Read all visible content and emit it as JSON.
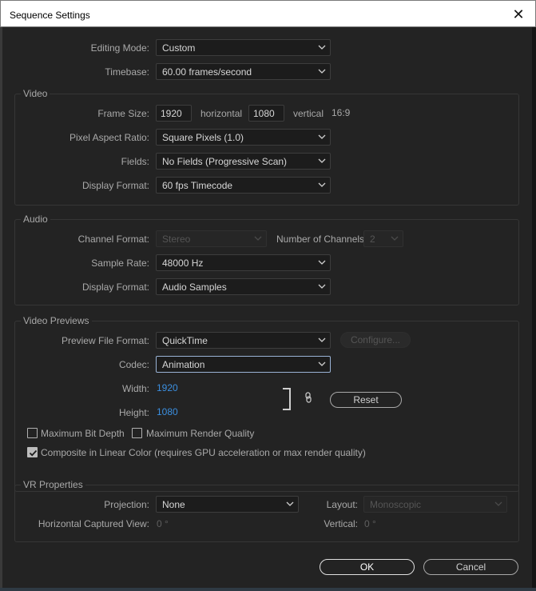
{
  "window": {
    "title": "Sequence Settings",
    "close_glyph": "✕"
  },
  "general": {
    "editing_mode": {
      "label": "Editing Mode:",
      "value": "Custom"
    },
    "timebase": {
      "label": "Timebase:",
      "value": "60.00  frames/second"
    }
  },
  "video": {
    "group_title": "Video",
    "frame_size": {
      "label": "Frame Size:",
      "width": "1920",
      "horizontal_label": "horizontal",
      "height": "1080",
      "vertical_label": "vertical",
      "aspect": "16:9"
    },
    "pixel_aspect_ratio": {
      "label": "Pixel Aspect Ratio:",
      "value": "Square Pixels (1.0)"
    },
    "fields": {
      "label": "Fields:",
      "value": "No Fields (Progressive Scan)"
    },
    "display_format": {
      "label": "Display Format:",
      "value": "60 fps Timecode"
    }
  },
  "audio": {
    "group_title": "Audio",
    "channel_format": {
      "label": "Channel Format:",
      "value": "Stereo"
    },
    "number_of_channels": {
      "label": "Number of Channels:",
      "value": "2"
    },
    "sample_rate": {
      "label": "Sample Rate:",
      "value": "48000 Hz"
    },
    "display_format": {
      "label": "Display Format:",
      "value": "Audio Samples"
    }
  },
  "previews": {
    "group_title": "Video Previews",
    "preview_file_format": {
      "label": "Preview File Format:",
      "value": "QuickTime"
    },
    "configure_label": "Configure...",
    "codec": {
      "label": "Codec:",
      "value": "Animation"
    },
    "width": {
      "label": "Width:",
      "value": "1920"
    },
    "height": {
      "label": "Height:",
      "value": "1080"
    },
    "reset_label": "Reset",
    "max_bit_depth": {
      "label": "Maximum Bit Depth",
      "checked": false
    },
    "max_render_quality": {
      "label": "Maximum Render Quality",
      "checked": false
    },
    "composite_linear": {
      "label": "Composite in Linear Color (requires GPU acceleration or max render quality)",
      "checked": true
    }
  },
  "vr": {
    "group_title": "VR Properties",
    "projection": {
      "label": "Projection:",
      "value": "None"
    },
    "layout": {
      "label": "Layout:",
      "value": "Monoscopic"
    },
    "h_captured_view": {
      "label": "Horizontal Captured View:",
      "value": "0 °"
    },
    "vertical": {
      "label": "Vertical:",
      "value": "0 °"
    }
  },
  "footer": {
    "ok_label": "OK",
    "cancel_label": "Cancel"
  },
  "icons": [
    "close-icon",
    "chevron-down-icon",
    "link-icon",
    "checkmark-icon"
  ],
  "colors": {
    "accent_blue": "#3b8fe0",
    "background": "#232323",
    "focus_border": "#9ab3d6"
  }
}
